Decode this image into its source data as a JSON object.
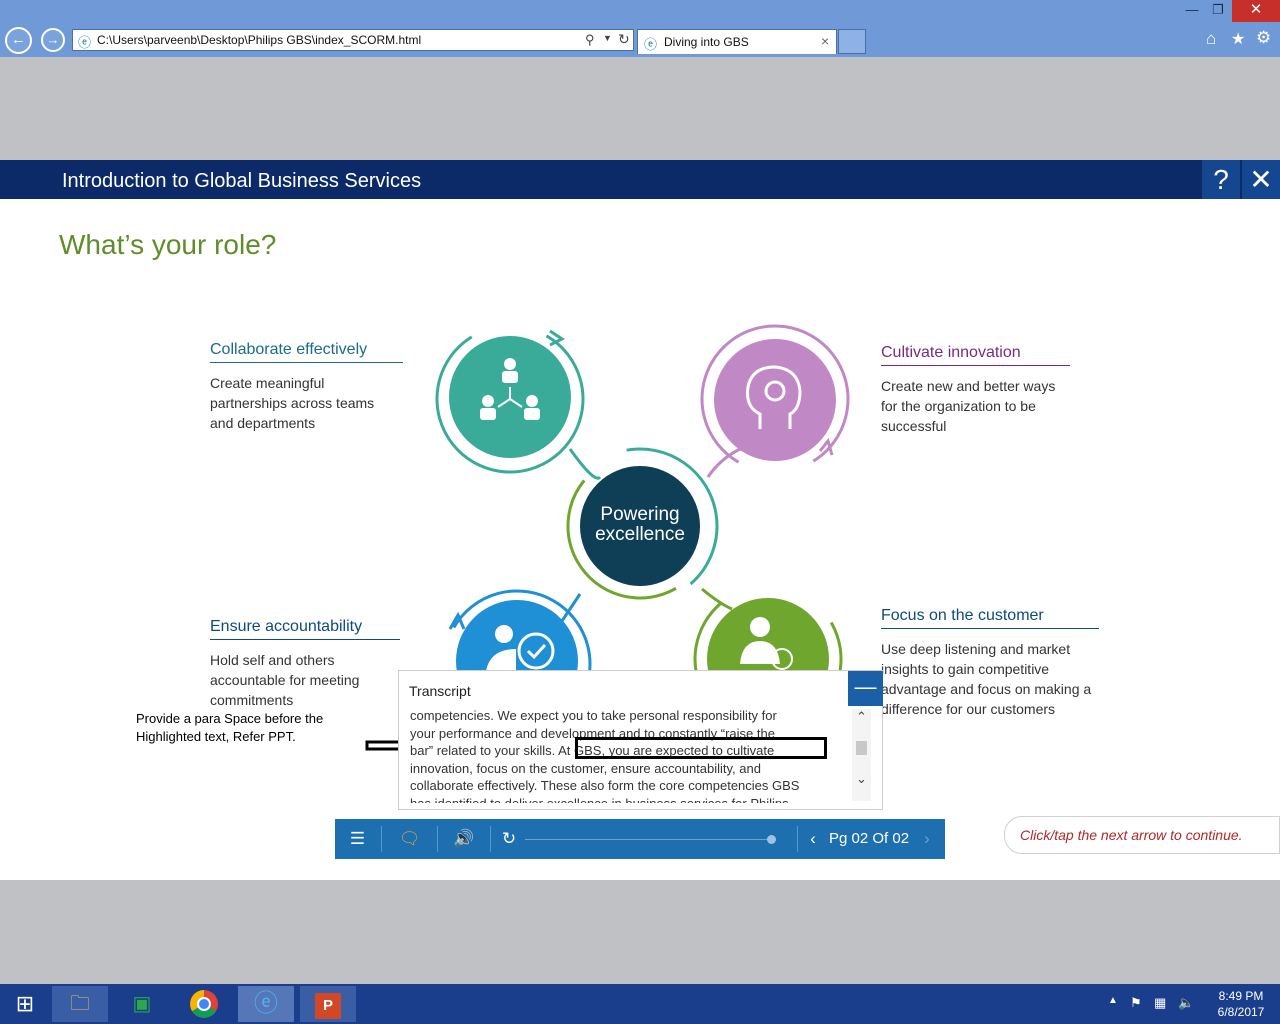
{
  "browser": {
    "address": "C:\\Users\\parveenb\\Desktop\\Philips GBS\\index_SCORM.html",
    "tab_title": "Diving into GBS",
    "tab_close": "×",
    "window_controls": {
      "minimize": "—",
      "restore": "❐",
      "close": "✕"
    }
  },
  "course": {
    "title": "Introduction to Global Business Services",
    "help_label": "?",
    "close_label": "✕"
  },
  "page": {
    "heading": "What’s your role?",
    "center_label": "Powering excellence",
    "roles": [
      {
        "title": "Collaborate effectively",
        "desc": "Create meaningful partnerships across teams and departments",
        "color": "#1b6b8c",
        "icon": "team-network-icon"
      },
      {
        "title": "Cultivate innovation",
        "desc": "Create new and better ways for the organization to be successful",
        "color": "#7a2a7f",
        "icon": "lightbulb-head-icon"
      },
      {
        "title": "Ensure accountability",
        "desc": "Hold self and others accountable for meeting commitments",
        "color": "#0e4b7c",
        "icon": "person-check-icon"
      },
      {
        "title": "Focus on the customer",
        "desc": "Use deep listening and market insights to gain competitive advantage and focus on making a difference for our customers",
        "color": "#0e4b7c",
        "icon": "customer-person-icon"
      }
    ],
    "colors": {
      "teal": "#3aab98",
      "purple": "#c088c4",
      "blue": "#1f8fd6",
      "green": "#6ea62e",
      "center": "#0e3f56"
    }
  },
  "transcript": {
    "title": "Transcript",
    "collapse_label": "—",
    "lines": [
      "competencies. We expect you to take personal responsibility for",
      "your performance and development and to constantly “raise the",
      "bar” related to your skills. At GBS, you are expected to cultivate",
      "innovation, focus on the customer, ensure accountability, and",
      "collaborate effectively. These also form the core competencies GBS",
      "has identified to deliver excellence in business services for Philips."
    ],
    "scroll_up": "⌃",
    "scroll_down": "⌄"
  },
  "annotation": {
    "note": "Provide a para Space before the Highlighted text, Refer PPT."
  },
  "player": {
    "page_indicator": "Pg 02 Of 02",
    "progress": 1.0,
    "menu_icon": "hamburger-menu-icon",
    "transcript_icon": "speech-bubble-icon",
    "audio_icon": "speaker-icon",
    "replay_icon": "replay-icon"
  },
  "continue_hint": "Click/tap the next arrow to continue.",
  "taskbar": {
    "time": "8:49 PM",
    "date": "6/8/2017"
  }
}
